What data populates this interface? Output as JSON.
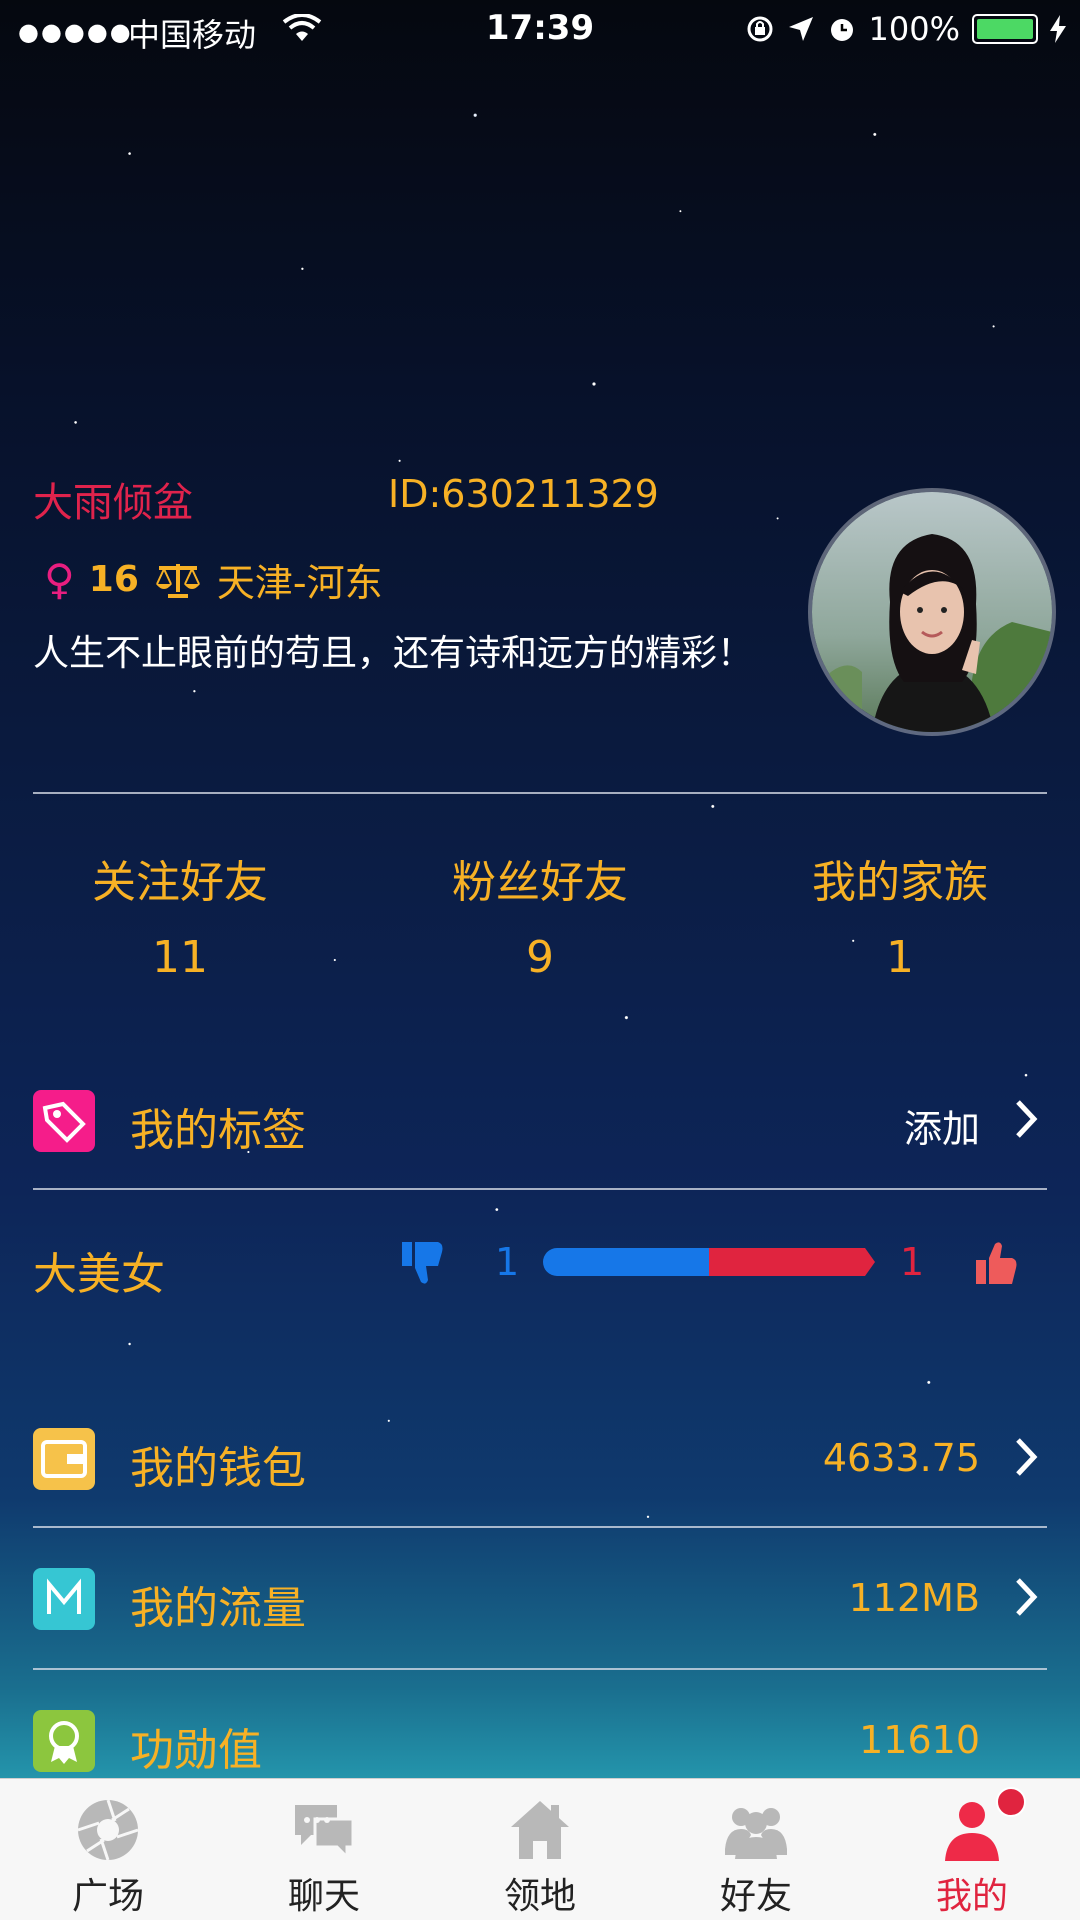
{
  "status_bar": {
    "signal": "●●●●●",
    "carrier": "中国移动",
    "time": "17:39",
    "battery": "100%"
  },
  "profile": {
    "name": "大雨倾盆",
    "id_text": "ID:630211329",
    "gender_symbol": "♀",
    "age": "16",
    "location": "天津-河东",
    "bio": "人生不止眼前的苟且，还有诗和远方的精彩！"
  },
  "stats": [
    {
      "label": "关注好友",
      "value": "11"
    },
    {
      "label": "粉丝好友",
      "value": "9"
    },
    {
      "label": "我的家族",
      "value": "1"
    }
  ],
  "tags": {
    "label": "我的标签",
    "action": "添加"
  },
  "vote": {
    "title": "大美女",
    "down_count": "1",
    "up_count": "1",
    "down_share": 0.5,
    "up_share": 0.5
  },
  "menu": [
    {
      "label": "我的钱包",
      "value": "4633.75",
      "icon": "wallet-icon"
    },
    {
      "label": "我的流量",
      "value": "112MB",
      "icon": "m-icon"
    },
    {
      "label": "功勋值",
      "value": "11610",
      "icon": "medal-icon"
    }
  ],
  "tabs": [
    {
      "label": "广场",
      "icon": "aperture-icon"
    },
    {
      "label": "聊天",
      "icon": "chat-icon"
    },
    {
      "label": "领地",
      "icon": "home-icon"
    },
    {
      "label": "好友",
      "icon": "friends-icon"
    },
    {
      "label": "我的",
      "icon": "user-icon",
      "active": true
    }
  ],
  "colors": {
    "accent": "#e0243f",
    "gold": "#f7b125",
    "blue": "#1677e8"
  }
}
